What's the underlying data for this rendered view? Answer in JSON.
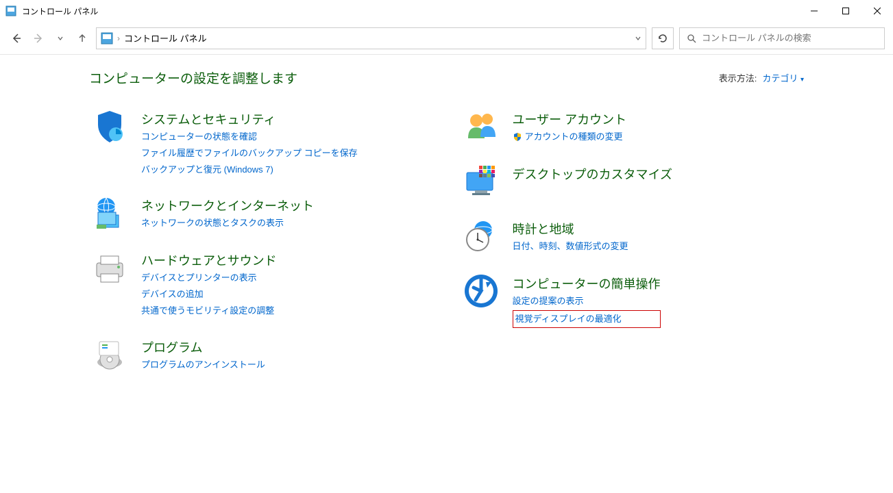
{
  "window": {
    "title": "コントロール パネル"
  },
  "nav": {
    "breadcrumb": "コントロール パネル",
    "search_placeholder": "コントロール パネルの検索"
  },
  "header": {
    "title": "コンピューターの設定を調整します",
    "view_label": "表示方法:",
    "view_value": "カテゴリ"
  },
  "left": [
    {
      "title": "システムとセキュリティ",
      "links": [
        "コンピューターの状態を確認",
        "ファイル履歴でファイルのバックアップ コピーを保存",
        "バックアップと復元 (Windows 7)"
      ]
    },
    {
      "title": "ネットワークとインターネット",
      "links": [
        "ネットワークの状態とタスクの表示"
      ]
    },
    {
      "title": "ハードウェアとサウンド",
      "links": [
        "デバイスとプリンターの表示",
        "デバイスの追加",
        "共通で使うモビリティ設定の調整"
      ]
    },
    {
      "title": "プログラム",
      "links": [
        "プログラムのアンインストール"
      ]
    }
  ],
  "right": [
    {
      "title": "ユーザー アカウント",
      "shield_link": "アカウントの種類の変更",
      "links": []
    },
    {
      "title": "デスクトップのカスタマイズ",
      "links": []
    },
    {
      "title": "時計と地域",
      "links": [
        "日付、時刻、数値形式の変更"
      ]
    },
    {
      "title": "コンピューターの簡単操作",
      "links": [
        "設定の提案の表示"
      ],
      "highlighted_link": "視覚ディスプレイの最適化"
    }
  ]
}
